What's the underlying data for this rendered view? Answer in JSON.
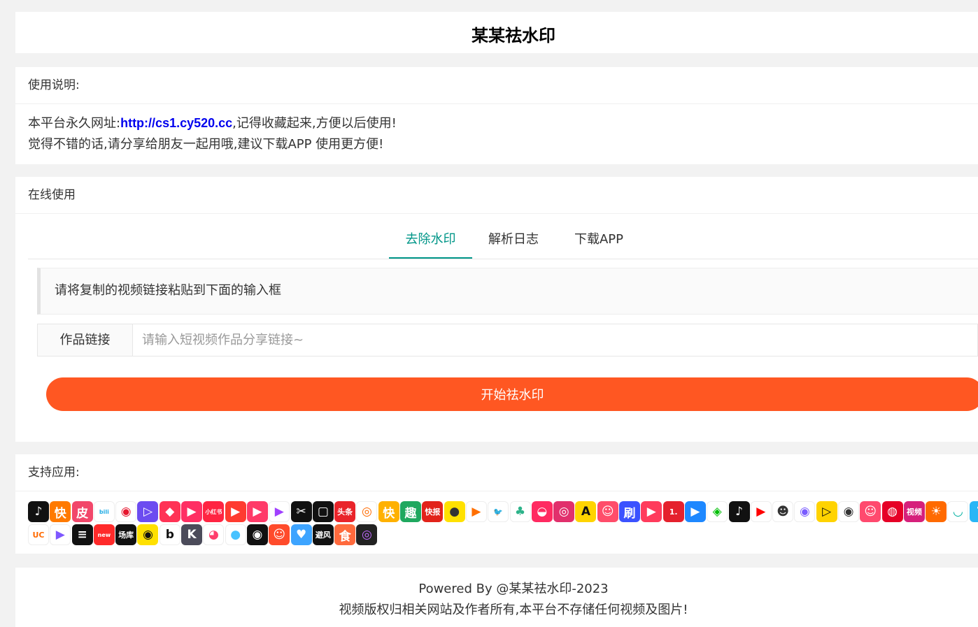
{
  "header": {
    "title": "某某祛水印"
  },
  "usage": {
    "heading": "使用说明:",
    "line1_prefix": "本平台永久网址:",
    "url": "http://cs1.cy520.cc",
    "line1_suffix": ",记得收藏起来,方便以后使用!",
    "line2": "觉得不错的话,请分享给朋友一起用哦,建议下载APP 使用更方便!"
  },
  "online": {
    "heading": "在线使用",
    "tabs": [
      {
        "label": "去除水印",
        "active": true
      },
      {
        "label": "解析日志",
        "active": false
      },
      {
        "label": "下载APP",
        "active": false
      }
    ],
    "hint": "请将复制的视频链接粘贴到下面的输入框",
    "input_label": "作品链接",
    "input_placeholder": "请输入短视频作品分享链接~",
    "input_value": "",
    "submit_label": "开始祛水印"
  },
  "apps": {
    "heading": "支持应用:",
    "row1": [
      {
        "name": "douyin-icon",
        "bg": "#111111",
        "glyph": "♪"
      },
      {
        "name": "kuaishou-icon",
        "bg": "#ff7a00",
        "glyph": "快"
      },
      {
        "name": "pipixia-icon",
        "bg": "#f2476a",
        "glyph": "皮"
      },
      {
        "name": "bilibili-icon",
        "bg": "#ffffff",
        "glyph": "bili",
        "fg": "#23ade5"
      },
      {
        "name": "weibo-icon",
        "bg": "#ffffff",
        "glyph": "◉",
        "fg": "#e6162d"
      },
      {
        "name": "weishi-icon",
        "bg": "#6c4cf0",
        "glyph": "▷"
      },
      {
        "name": "meipai-icon",
        "bg": "#ff3355",
        "glyph": "◆"
      },
      {
        "name": "zuiyou-icon",
        "bg": "#ff2e63",
        "glyph": "▶"
      },
      {
        "name": "xiaohongshu-icon",
        "bg": "#ff2442",
        "glyph": "小红书"
      },
      {
        "name": "huoshan-icon",
        "bg": "#ff3b30",
        "glyph": "▶"
      },
      {
        "name": "haokan-icon",
        "bg": "#ff3a68",
        "glyph": "▶"
      },
      {
        "name": "weishi2-icon",
        "bg": "#ffffff",
        "glyph": "▶",
        "fg": "#a040ff"
      },
      {
        "name": "capcut-icon",
        "bg": "#111111",
        "glyph": "✂"
      },
      {
        "name": "xigua-icon",
        "bg": "#111111",
        "glyph": "▢"
      },
      {
        "name": "toutiao-icon",
        "bg": "#e9242a",
        "glyph": "头条"
      },
      {
        "name": "lvzhou-icon",
        "bg": "#ffffff",
        "glyph": "◎",
        "fg": "#ff6a00"
      },
      {
        "name": "kuaishouexpress-icon",
        "bg": "#ffb100",
        "glyph": "快"
      },
      {
        "name": "qutoutiao-icon",
        "bg": "#1fa85f",
        "glyph": "趣"
      },
      {
        "name": "kuaibao-icon",
        "bg": "#e2231a",
        "glyph": "快报"
      },
      {
        "name": "yiqi-icon",
        "bg": "#ffe100",
        "glyph": "●",
        "fg": "#333"
      },
      {
        "name": "zhibo-icon",
        "bg": "#ffffff",
        "glyph": "▶",
        "fg": "#ff6f00"
      },
      {
        "name": "twitter-icon",
        "bg": "#ffffff",
        "glyph": "🐦",
        "fg": "#1da1f2"
      },
      {
        "name": "lvzhou2-icon",
        "bg": "#ffffff",
        "glyph": "♣",
        "fg": "#2db38a"
      },
      {
        "name": "momo-icon",
        "bg": "#ff2a61",
        "glyph": "◒"
      },
      {
        "name": "instagram-icon",
        "bg": "#e1306c",
        "glyph": "◎"
      },
      {
        "name": "acfun-icon",
        "bg": "#ffd400",
        "glyph": "A",
        "fg": "#111"
      },
      {
        "name": "tantan-icon",
        "bg": "#ff4d6a",
        "glyph": "☺"
      },
      {
        "name": "shua-icon",
        "bg": "#3b52ff",
        "glyph": "刷"
      },
      {
        "name": "quanmin-icon",
        "bg": "#ff3b5c",
        "glyph": "▶"
      },
      {
        "name": "yidian-icon",
        "bg": "#e5212d",
        "glyph": "1."
      },
      {
        "name": "youku-icon",
        "bg": "#1e88ff",
        "glyph": "▶"
      },
      {
        "name": "iqiyi-icon",
        "bg": "#ffffff",
        "glyph": "◈",
        "fg": "#00be06"
      },
      {
        "name": "tiktok-icon",
        "bg": "#111111",
        "glyph": "♪"
      },
      {
        "name": "youtube-icon",
        "bg": "#ffffff",
        "glyph": "▶",
        "fg": "#ff0000"
      },
      {
        "name": "doudou-icon",
        "bg": "#ffffff",
        "glyph": "☻",
        "fg": "#333"
      },
      {
        "name": "qq-icon",
        "bg": "#ffffff",
        "glyph": "◉",
        "fg": "#7a5cff"
      },
      {
        "name": "lishipin-icon",
        "bg": "#ffd300",
        "glyph": "▷",
        "fg": "#111"
      },
      {
        "name": "lens-icon",
        "bg": "#ffffff",
        "glyph": "◉",
        "fg": "#333"
      },
      {
        "name": "face-icon",
        "bg": "#ff4a6e",
        "glyph": "☺"
      },
      {
        "name": "netease-icon",
        "bg": "#e60026",
        "glyph": "◍"
      },
      {
        "name": "shipinhao-icon",
        "bg": "#d6207b",
        "glyph": "视频"
      },
      {
        "name": "lion-icon",
        "bg": "#ff6a00",
        "glyph": "☀"
      },
      {
        "name": "bowl-icon",
        "bg": "#ffffff",
        "glyph": "◡",
        "fg": "#00b0a0"
      },
      {
        "name": "partial-icon",
        "bg": "#29b6f6",
        "glyph": "?"
      }
    ],
    "row2": [
      {
        "name": "uc-icon",
        "bg": "#ffffff",
        "glyph": "UC",
        "fg": "#ff6a00"
      },
      {
        "name": "weishi3-icon",
        "bg": "#ffffff",
        "glyph": "▶",
        "fg": "#7e57ff"
      },
      {
        "name": "stripes-icon",
        "bg": "#111111",
        "glyph": "≡"
      },
      {
        "name": "new-icon",
        "bg": "#ff2a2a",
        "glyph": "new"
      },
      {
        "name": "changku-icon",
        "bg": "#111111",
        "glyph": "场库"
      },
      {
        "name": "play-yellow-icon",
        "bg": "#ffe000",
        "glyph": "◉",
        "fg": "#111"
      },
      {
        "name": "b-icon",
        "bg": "#ffffff",
        "glyph": "b",
        "fg": "#111"
      },
      {
        "name": "k-icon",
        "bg": "#4b4b5a",
        "glyph": "K"
      },
      {
        "name": "chat-icon",
        "bg": "#ffffff",
        "glyph": "◕",
        "fg": "#ff3e6c"
      },
      {
        "name": "circle-icon",
        "bg": "#ffffff",
        "glyph": "●",
        "fg": "#47c2ff"
      },
      {
        "name": "eyes-icon",
        "bg": "#111111",
        "glyph": "◉"
      },
      {
        "name": "monkey-icon",
        "bg": "#ff4b2b",
        "glyph": "☺"
      },
      {
        "name": "heart-icon",
        "bg": "#3da4ff",
        "glyph": "♥"
      },
      {
        "name": "biwind-icon",
        "bg": "#111111",
        "glyph": "避风"
      },
      {
        "name": "shi-icon",
        "bg": "#ff6a3d",
        "glyph": "食"
      },
      {
        "name": "ring-icon",
        "bg": "#222222",
        "glyph": "◎",
        "fg": "#c06bff"
      }
    ]
  },
  "footer": {
    "line1": "Powered By @某某祛水印-2023",
    "line2": "视频版权归相关网站及作者所有,本平台不存储任何视频及图片!"
  }
}
